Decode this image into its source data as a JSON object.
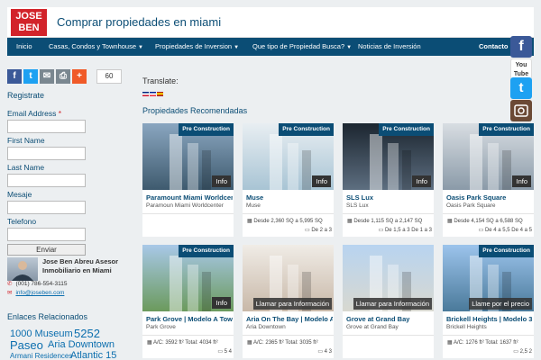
{
  "header": {
    "logo_line1": "JOSE",
    "logo_line2": "BEN",
    "title": "Comprar propiedades en miami"
  },
  "nav": {
    "items": [
      {
        "label": "Inicio",
        "has_dropdown": false
      },
      {
        "label": "Casas, Condos y Townhouse",
        "has_dropdown": true
      },
      {
        "label": "Propiedades de Inversion",
        "has_dropdown": true
      },
      {
        "label": "Que tipo de Propiedad Busca?",
        "has_dropdown": true
      },
      {
        "label": "Noticias de Inversión",
        "has_dropdown": false
      },
      {
        "label": "Contacto",
        "has_dropdown": false
      }
    ]
  },
  "social_side": [
    {
      "icon": "facebook-icon",
      "glyph": "f",
      "color": "#3b5998"
    },
    {
      "icon": "youtube-icon",
      "glyph": "You Tube",
      "color": "#e52d27"
    },
    {
      "icon": "twitter-icon",
      "glyph": "t",
      "color": "#1da1f2"
    },
    {
      "icon": "instagram-icon",
      "glyph": "",
      "color": "#6b4a36"
    },
    {
      "icon": "youtube-icon",
      "glyph": "You Tube",
      "color": "#e52d27"
    }
  ],
  "share": {
    "count": "60",
    "buttons": [
      {
        "icon": "facebook-icon",
        "glyph": "f",
        "color": "#3b5998"
      },
      {
        "icon": "twitter-icon",
        "glyph": "t",
        "color": "#1da1f2"
      },
      {
        "icon": "email-icon",
        "glyph": "✉",
        "color": "#7a8790"
      },
      {
        "icon": "print-icon",
        "glyph": "⎙",
        "color": "#7a8790"
      },
      {
        "icon": "plus-icon",
        "glyph": "+",
        "color": "#f05a28"
      }
    ]
  },
  "form": {
    "title": "Registrate",
    "fields": [
      {
        "label": "Email Address",
        "required_mark": "*"
      },
      {
        "label": "First Name",
        "required_mark": ""
      },
      {
        "label": "Last Name",
        "required_mark": ""
      },
      {
        "label": "Mesaje",
        "required_mark": ""
      },
      {
        "label": "Telefono",
        "required_mark": ""
      }
    ],
    "submit_label": "Enviar"
  },
  "agent": {
    "name": "Jose Ben Abreu Asesor Inmobiliario en Miami",
    "phone": "(001) 786-554-3115",
    "email": "info@joseben.com"
  },
  "related": {
    "title": "Enlaces Relacionados",
    "tags": [
      {
        "text": "1000 Museum",
        "size": 11
      },
      {
        "text": "5252",
        "size": 13
      },
      {
        "text": "Paseo",
        "size": 13
      },
      {
        "text": "Aria Downtown",
        "size": 11
      },
      {
        "text": "Armani Residences",
        "size": 8
      },
      {
        "text": "Atlantic 15",
        "size": 11
      }
    ]
  },
  "translate": {
    "label": "Translate:"
  },
  "properties": {
    "title": "Propiedades Recomendadas",
    "cards": [
      {
        "badge": "Pre Construction",
        "overlay": "Info",
        "name": "Paramount Miami Worldcenter",
        "sub": "Paramoun Miami Worldcenter",
        "stats1": "",
        "stats2": "",
        "img_top": "#8aa6c0",
        "img_bottom": "#3e5a6e"
      },
      {
        "badge": "Pre Construction",
        "overlay": "Info",
        "name": "Muse",
        "sub": "Muse",
        "stats1": "Desde 2,360 SQ a 5,995 SQ",
        "stats2": "De 2 a 3",
        "img_top": "#e8eef2",
        "img_bottom": "#a8c4d4"
      },
      {
        "badge": "Pre Construction",
        "overlay": "Info",
        "name": "SLS Lux",
        "sub": "SLS Lux",
        "stats1": "Desde 1,115 SQ a 2,147 SQ",
        "stats2": "De 1,5 a 3   De 1 a 3",
        "img_top": "#1c2630",
        "img_bottom": "#5d6e80"
      },
      {
        "badge": "Pre Construction",
        "overlay": "Info",
        "name": "Oasis Park Square",
        "sub": "Oasis Park Square",
        "stats1": "Desde 4,154 SQ a 6,588 SQ",
        "stats2": "De 4 a 5,5   De 4 a 5",
        "img_top": "#d8dde2",
        "img_bottom": "#8a9aa8"
      },
      {
        "badge": "Pre Construction",
        "overlay": "Info",
        "name": "Park Grove | Modelo A Tower",
        "sub": "Park Grove",
        "stats1": "A/C: 3592 ft²  Total: 4034 ft²",
        "stats2": "5   4",
        "img_top": "#a8c8e8",
        "img_bottom": "#6b9a5c"
      },
      {
        "badge": "",
        "overlay": "Llamar para Información",
        "name": "Aria On The Bay | Modelo A",
        "sub": "Aria Downtown",
        "stats1": "A/C: 2365 ft²  Total: 3035 ft²",
        "stats2": "4   3",
        "img_top": "#f0ece6",
        "img_bottom": "#c8b8a8"
      },
      {
        "badge": "",
        "overlay": "Llamar para Información",
        "name": "Grove at Grand Bay",
        "sub": "Grove at Grand Bay",
        "stats1": "",
        "stats2": "",
        "img_top": "#b8d4f0",
        "img_bottom": "#d8d8d0"
      },
      {
        "badge": "Pre Construction",
        "overlay": "Llame por el precio",
        "name": "Brickell Heights | Modelo 3",
        "sub": "Brickell Heights",
        "stats1": "A/C: 1276 ft²  Total: 1637 ft²",
        "stats2": "2,5   2",
        "img_top": "#9cc4ec",
        "img_bottom": "#4a7a9a"
      }
    ]
  }
}
